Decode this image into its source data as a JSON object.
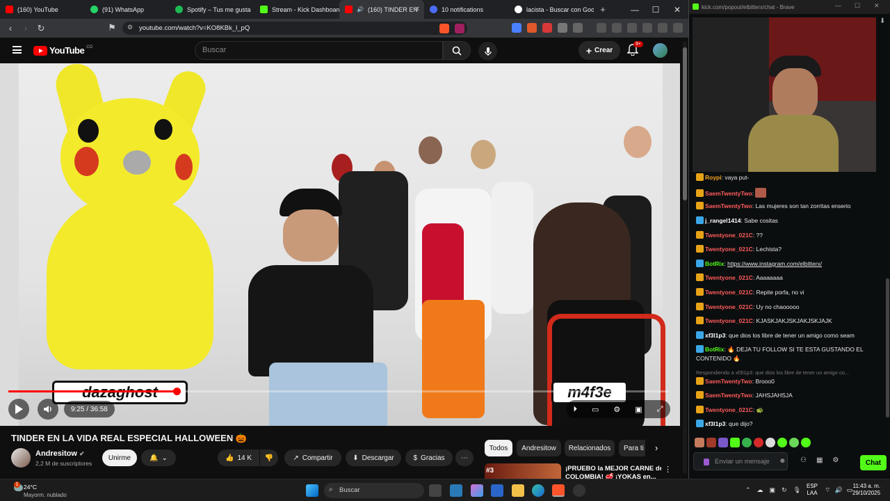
{
  "browser": {
    "tabs": [
      {
        "label": "(160) YouTube",
        "color": "#ff0000"
      },
      {
        "label": "(91) WhatsApp",
        "color": "#25d366"
      },
      {
        "label": "Spotify – Tus me gusta",
        "color": "#1db954"
      },
      {
        "label": "Stream - Kick Dashboard",
        "color": "#53fc18"
      },
      {
        "label": "(160) TINDER EN",
        "color": "#ff0000"
      },
      {
        "label": "10 notifications",
        "color": "#4a6cf7"
      },
      {
        "label": "lacista - Buscar con Goo",
        "color": "#888888"
      }
    ],
    "url": "youtube.com/watch?v=KO8KBk_l_pQ"
  },
  "youtube": {
    "logo_text": "YouTube",
    "logo_sup": "CO",
    "search_placeholder": "Buscar",
    "create_label": "Crear",
    "notif_count": "9+",
    "video": {
      "overlay_left": "dazaghost",
      "overlay_right": "m4f3e",
      "time": "9:25 / 36:58",
      "progress": 0.255
    },
    "title": "TINDER EN LA VIDA REAL ESPECIAL HALLOWEEN 🎃",
    "channel": "Andresitow",
    "subscribers": "2,2 M de suscriptores",
    "join_label": "Unirme",
    "likes": "14 K",
    "share_label": "Compartir",
    "download_label": "Descargar",
    "thanks_label": "Gracias",
    "chips": [
      "Todos",
      "Andresitow",
      "Relacionados",
      "Para ti"
    ],
    "rec": {
      "rank": "#3",
      "title_line1": "¡PRUEBO la MEJOR CARNE de",
      "title_line2": "COLOMBIA! 🥩 ¡YOKAS en..."
    }
  },
  "kick": {
    "window_url": "kick.com/popout/elbitterx/chat - Brave",
    "messages": [
      {
        "user": "Roypi",
        "text": "vaya put-",
        "color": "#f5a623"
      },
      {
        "user": "SaemTwentyTwo",
        "text": "",
        "color": "#ff5c5c"
      },
      {
        "user": "SaemTwentyTwo",
        "text": "Las mujeres son tan zorritas enserio",
        "color": "#ff5c5c"
      },
      {
        "user": "j_rangel1414",
        "text": "Sabe cositas",
        "color": "#ffffff"
      },
      {
        "user": "Twentyone_021C",
        "text": "??",
        "color": "#ff5c5c"
      },
      {
        "user": "Twentyone_021C",
        "text": "Lechista?",
        "color": "#ff5c5c"
      },
      {
        "user": "BotRix",
        "text": "https://www.instagram.com/elbitterx/",
        "color": "#53fc18"
      },
      {
        "user": "Twentyone_021C",
        "text": "Aaaaaaaa",
        "color": "#ff5c5c"
      },
      {
        "user": "Twentyone_021C",
        "text": "Repite porfa, no vi",
        "color": "#ff5c5c"
      },
      {
        "user": "Twentyone_021C",
        "text": "Uy no chaooooo",
        "color": "#ff5c5c"
      },
      {
        "user": "Twentyone_021C",
        "text": "KJASKJAKJSKJAKJSKJAJK",
        "color": "#ff5c5c"
      },
      {
        "user": "xf3l1p3",
        "text": "que dios los libre de tener un amigo como seam",
        "color": "#ffffff"
      },
      {
        "user": "BotRix",
        "text": "🔥 DEJA TU FOLLOW SI TE ESTA GUSTANDO EL CONTENIDO 🔥",
        "color": "#53fc18"
      },
      {
        "user": "SaemTwentyTwo",
        "text": "Brooo0",
        "color": "#ff5c5c"
      },
      {
        "user": "SaemTwentyTwo",
        "text": "JAHSJAHSJA",
        "color": "#ff5c5c"
      },
      {
        "user": "Twentyone_021C",
        "text": "🐢",
        "color": "#ff5c5c"
      },
      {
        "user": "xf3l1p3",
        "text": "que dijo?",
        "color": "#ffffff"
      }
    ],
    "reply_note": "Respondiendo a xf3l1p3: que dios los libre de tener un amigo co...",
    "input_placeholder": "Enviar un mensaje",
    "chat_button": "Chat"
  },
  "taskbar": {
    "weather_temp": "24°C",
    "weather_desc": "Mayorm. nublado",
    "weather_badge": "1",
    "search_placeholder": "Buscar",
    "lang_line1": "ESP",
    "lang_line2": "LAA",
    "time": "11:43 a. m.",
    "date": "29/10/2025"
  }
}
